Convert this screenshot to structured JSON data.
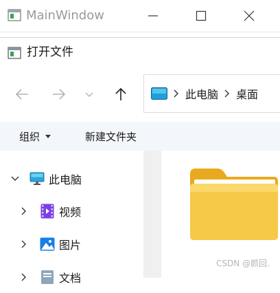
{
  "main_window": {
    "title": "MainWindow"
  },
  "dialog": {
    "title": "打开文件",
    "address": {
      "segments": [
        "此电脑",
        "桌面"
      ]
    },
    "command_bar": {
      "organize_label": "组织",
      "new_folder_label": "新建文件夹"
    },
    "nav_pane": {
      "items": [
        {
          "label": "此电脑",
          "icon": "monitor-icon",
          "expanded": true
        },
        {
          "label": "视频",
          "icon": "video-folder-icon",
          "expanded": false
        },
        {
          "label": "图片",
          "icon": "pictures-folder-icon",
          "expanded": false
        },
        {
          "label": "文档",
          "icon": "documents-folder-icon",
          "expanded": false
        }
      ]
    },
    "content": {
      "items": [
        {
          "type": "folder",
          "icon": "folder-icon"
        }
      ]
    }
  },
  "watermark": "CSDN @颜回.",
  "colors": {
    "command_bar_bg": "#f3f6fa",
    "folder_yellow": "#f7c948",
    "video_purple": "#7b3fe4",
    "pictures_blue": "#1a7ee6"
  }
}
